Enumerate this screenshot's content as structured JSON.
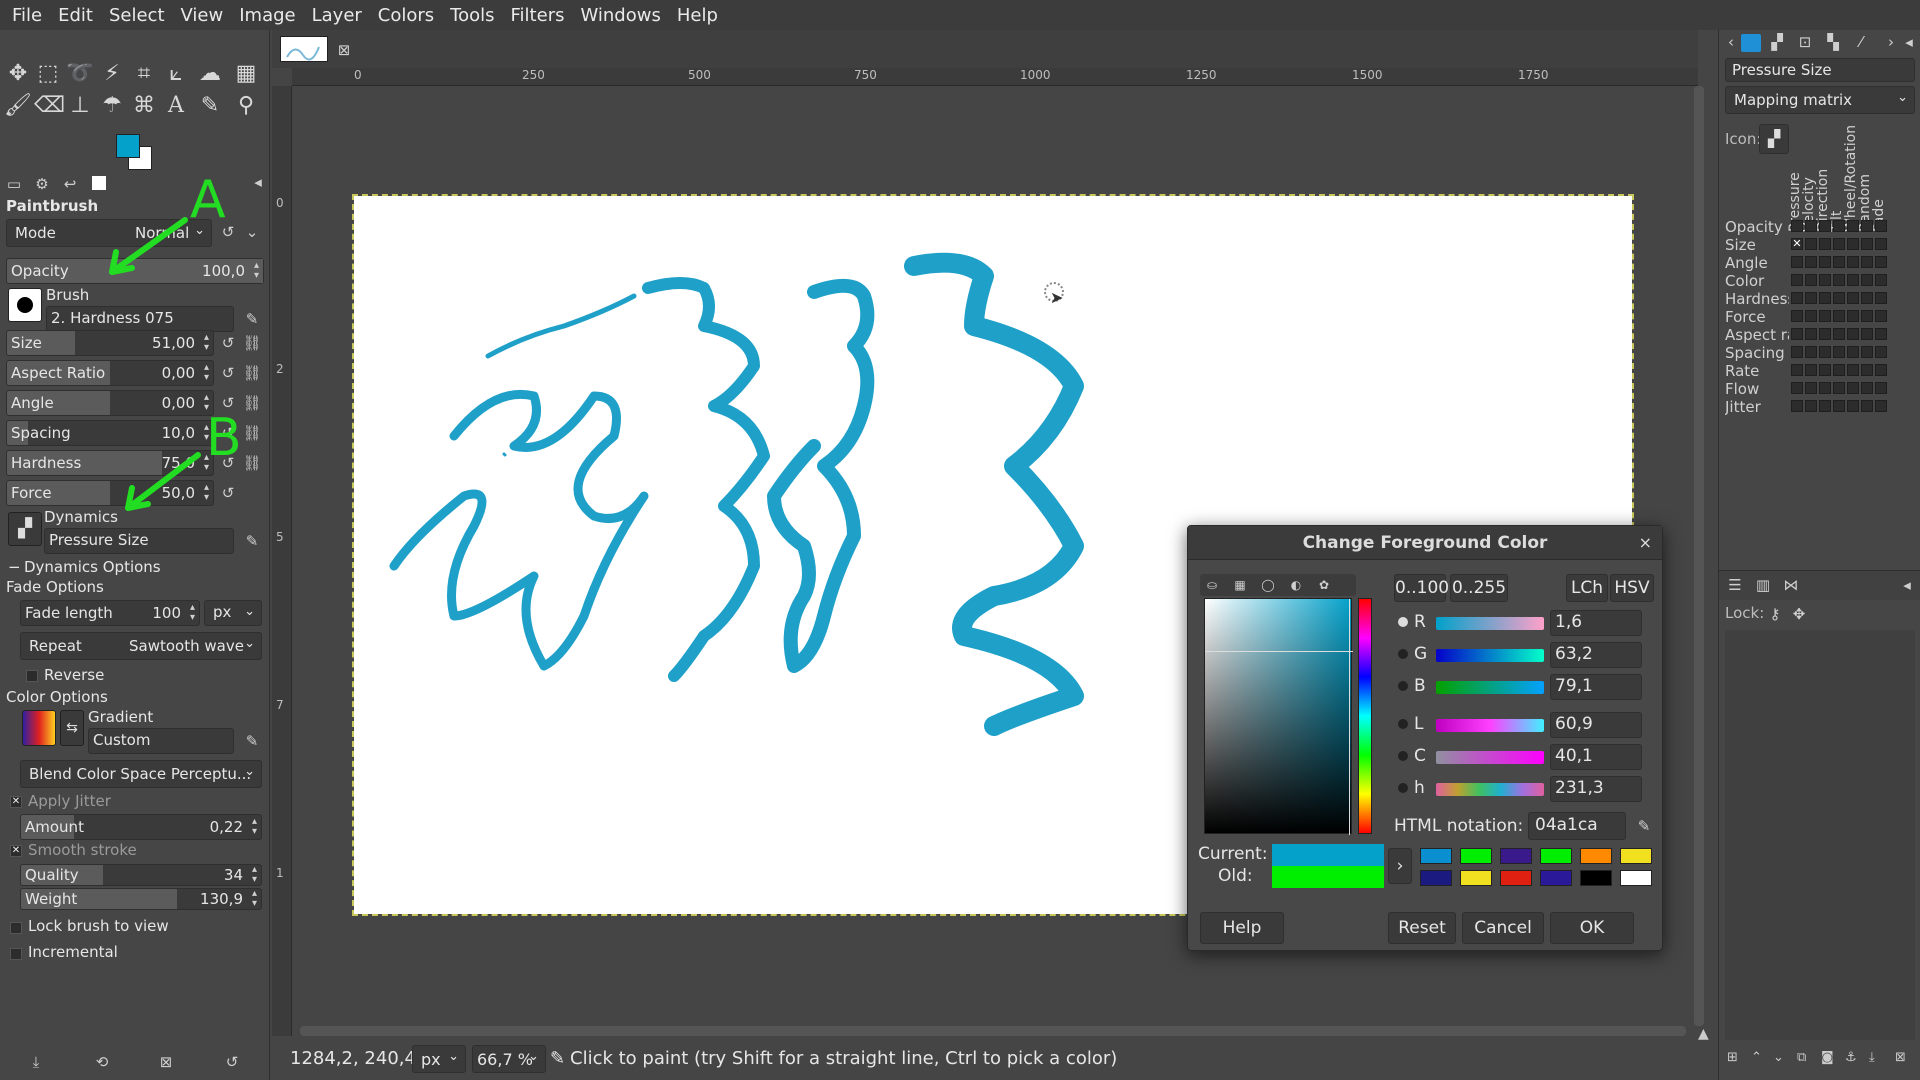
{
  "menu": [
    "File",
    "Edit",
    "Select",
    "View",
    "Image",
    "Layer",
    "Colors",
    "Tools",
    "Filters",
    "Windows",
    "Help"
  ],
  "colors": {
    "fg": "#04a1ca",
    "old": "#00ee00",
    "accent": "#1fa0c8"
  },
  "annotations": {
    "a": "A",
    "b": "B"
  },
  "tool_options": {
    "title": "Paintbrush",
    "mode_label": "Mode",
    "mode_value": "Normal",
    "opacity": {
      "label": "Opacity",
      "value": "100,0",
      "fraction": 1.0
    },
    "brush_label": "Brush",
    "brush_name": "2. Hardness 075",
    "size": {
      "label": "Size",
      "value": "51,00",
      "fraction": 0.33
    },
    "aspect_ratio": {
      "label": "Aspect Ratio",
      "value": "0,00",
      "fraction": 0.5
    },
    "angle": {
      "label": "Angle",
      "value": "0,00",
      "fraction": 0.5
    },
    "spacing": {
      "label": "Spacing",
      "value": "10,0",
      "fraction": 0.1
    },
    "hardness": {
      "label": "Hardness",
      "value": "75,0",
      "fraction": 0.75
    },
    "force": {
      "label": "Force",
      "value": "50,0",
      "fraction": 0.5
    },
    "dynamics_label": "Dynamics",
    "dynamics_name": "Pressure Size",
    "dynamics_options": "Dynamics Options",
    "fade_options": "Fade Options",
    "fade_length": {
      "label": "Fade length",
      "value": "100",
      "unit": "px"
    },
    "repeat": {
      "label": "Repeat",
      "value": "Sawtooth wave"
    },
    "reverse": "Reverse",
    "color_options": "Color Options",
    "gradient_label": "Gradient",
    "gradient_name": "Custom",
    "blend_space": "Blend Color Space Perceptu...",
    "apply_jitter": "Apply Jitter",
    "amount": {
      "label": "Amount",
      "value": "0,22",
      "fraction": 0.22
    },
    "smooth_stroke": "Smooth stroke",
    "quality": {
      "label": "Quality",
      "value": "34",
      "fraction": 0.34
    },
    "weight": {
      "label": "Weight",
      "value": "130,9",
      "fraction": 0.65
    },
    "lock_brush": "Lock brush to view",
    "incremental": "Incremental"
  },
  "rulers": {
    "h": [
      "0",
      "250",
      "500",
      "750",
      "1000",
      "1250",
      "1500",
      "1750"
    ],
    "v": [
      "0",
      "2",
      "5",
      "7",
      "1"
    ]
  },
  "status": {
    "coords": "1284,2, 240,4",
    "unit": "px",
    "zoom": "66,7 %",
    "message": "Click to paint (try Shift for a straight line, Ctrl to pick a color)"
  },
  "dialog": {
    "title": "Change Foreground Color",
    "range_100": "0..100",
    "range_255": "0..255",
    "lch": "LCh",
    "hsv": "HSV",
    "channels": [
      {
        "name": "R",
        "value": "1,6"
      },
      {
        "name": "G",
        "value": "63,2"
      },
      {
        "name": "B",
        "value": "79,1"
      },
      {
        "name": "L",
        "value": "60,9"
      },
      {
        "name": "C",
        "value": "40,1"
      },
      {
        "name": "h",
        "value": "231,3"
      }
    ],
    "html_label": "HTML notation:",
    "html_value": "04a1ca",
    "current_label": "Current:",
    "old_label": "Old:",
    "history": [
      "#0a8fd0",
      "#00ee00",
      "#3a1a8a",
      "#00ee00",
      "#ff8a00",
      "#f0e020",
      "#1a1a80",
      "#f0e020",
      "#e02010",
      "#2a1a9a",
      "#000000",
      "#ffffff"
    ],
    "help": "Help",
    "reset": "Reset",
    "cancel": "Cancel",
    "ok": "OK"
  },
  "right_dock": {
    "dynamics_name": "Pressure Size",
    "mapping": "Mapping matrix",
    "icon_label": "Icon:",
    "columns": [
      "Pressure",
      "Velocity",
      "Direction",
      "Tilt",
      "Wheel/Rotation",
      "Random",
      "Fade"
    ],
    "rows": [
      "Opacity",
      "Size",
      "Angle",
      "Color",
      "Hardness",
      "Force",
      "Aspect ratio",
      "Spacing",
      "Rate",
      "Flow",
      "Jitter"
    ],
    "lock_label": "Lock:"
  }
}
